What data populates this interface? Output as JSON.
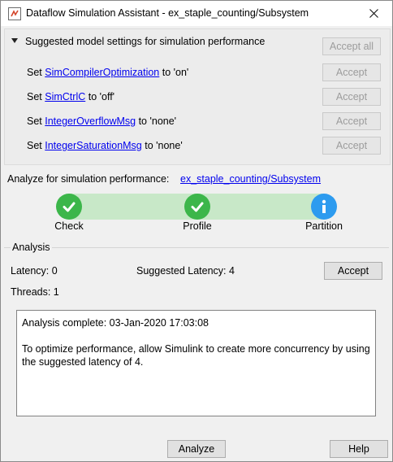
{
  "window": {
    "title": "Dataflow Simulation Assistant - ex_staple_counting/Subsystem"
  },
  "settings": {
    "section_title": "Suggested model settings for simulation performance",
    "accept_all_label": "Accept all",
    "rows": [
      {
        "prefix": "Set ",
        "param": "SimCompilerOptimization",
        "suffix": " to 'on'",
        "accept_label": "Accept"
      },
      {
        "prefix": "Set ",
        "param": "SimCtrlC",
        "suffix": " to 'off'",
        "accept_label": "Accept"
      },
      {
        "prefix": "Set ",
        "param": "IntegerOverflowMsg",
        "suffix": " to 'none'",
        "accept_label": "Accept"
      },
      {
        "prefix": "Set ",
        "param": "IntegerSaturationMsg",
        "suffix": " to 'none'",
        "accept_label": "Accept"
      }
    ]
  },
  "analyze": {
    "label": "Analyze for simulation performance:",
    "target_link": "ex_staple_counting/Subsystem",
    "steps": [
      {
        "label": "Check",
        "status": "complete",
        "icon": "checkmark-icon"
      },
      {
        "label": "Profile",
        "status": "complete",
        "icon": "checkmark-icon"
      },
      {
        "label": "Partition",
        "status": "info",
        "icon": "info-icon"
      }
    ]
  },
  "analysis": {
    "section_label": "Analysis",
    "latency_text": "Latency: 0",
    "suggested_latency_text": "Suggested Latency: 4",
    "threads_text": "Threads: 1",
    "accept_label": "Accept",
    "message_line1": "Analysis complete: 03-Jan-2020 17:03:08",
    "message_line2": "To optimize performance, allow Simulink to create more concurrency by using the suggested latency of 4."
  },
  "footer": {
    "analyze_label": "Analyze",
    "help_label": "Help"
  },
  "colors": {
    "success_green": "#3cb64a",
    "info_blue": "#2d9bef",
    "progress_track": "#c8e8c8",
    "link_blue": "#0000ee"
  }
}
